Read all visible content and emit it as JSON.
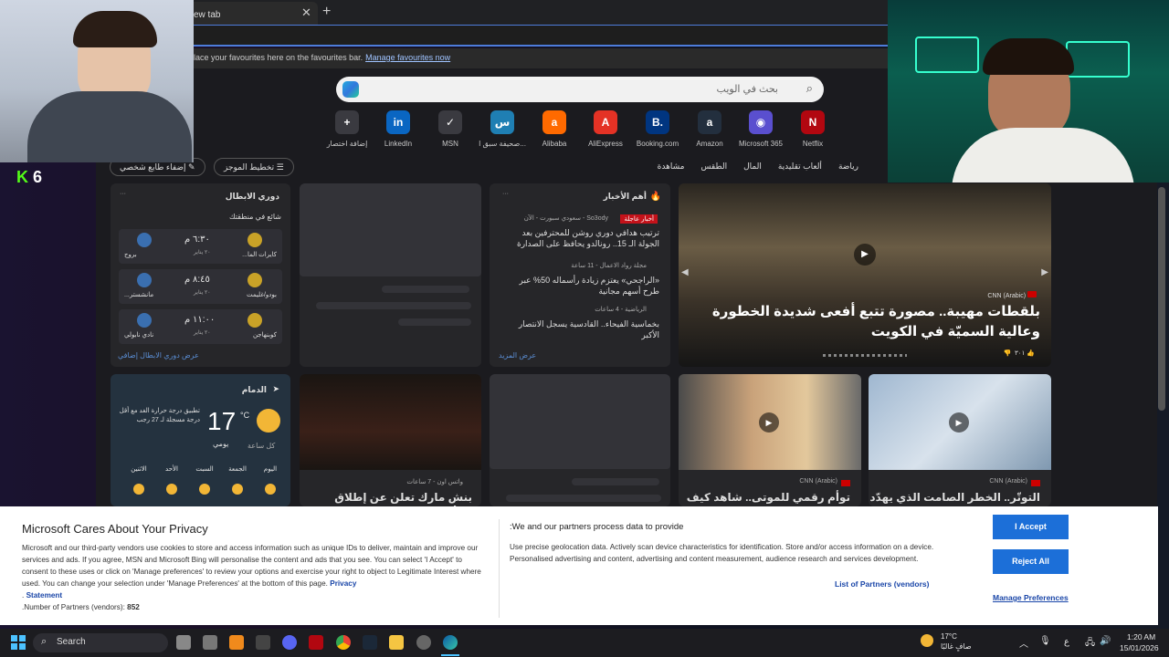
{
  "browser": {
    "tab_title": "ew tab",
    "close_glyph": "✕",
    "new_tab_glyph": "+",
    "fav_text": "lace your favourites here on the favourites bar.",
    "fav_link": "Manage favourites now"
  },
  "search": {
    "placeholder": "بحث في الويب"
  },
  "quick_links": [
    {
      "label": "إضافة اختصار",
      "glyph": "+",
      "color": "#3a3a40"
    },
    {
      "label": "LinkedIn",
      "glyph": "in",
      "color": "#0a66c2"
    },
    {
      "label": "MSN",
      "glyph": "✓",
      "color": "#3a3a40"
    },
    {
      "label": "صحيفة سبق ا...",
      "glyph": "س",
      "color": "#1f7fb3"
    },
    {
      "label": "Alibaba",
      "glyph": "a",
      "color": "#ff6a00"
    },
    {
      "label": "AliExpress",
      "glyph": "A",
      "color": "#e43225"
    },
    {
      "label": "Booking.com",
      "glyph": "B.",
      "color": "#003580"
    },
    {
      "label": "Amazon",
      "glyph": "a",
      "color": "#232f3e"
    },
    {
      "label": "Microsoft 365",
      "glyph": "◉",
      "color": "#5a4fcf"
    },
    {
      "label": "Netflix",
      "glyph": "N",
      "color": "#b20710"
    }
  ],
  "toolbar": {
    "personalize": "إضفاء طابع شخصي",
    "layout": "تخطيط الموجز"
  },
  "nav_links": [
    "رياضة",
    "ألعاب تقليدية",
    "المال",
    "الطقس",
    "مشاهدة"
  ],
  "league": {
    "title": "دوري الابطال",
    "trending": "شائع في منطقتك",
    "matches": [
      {
        "home": "كايرات الما...",
        "away": "بروج",
        "time": "٦:٣٠ م",
        "date": "٢٠ يناير"
      },
      {
        "home": "بودو/غليمت",
        "away": "مانشستر...",
        "time": "٨:٤٥ م",
        "date": "٢٠ يناير"
      },
      {
        "home": "كوبنهاجن",
        "away": "نادي نابولي",
        "time": "١١:٠٠ م",
        "date": "٢٠ يناير"
      }
    ],
    "more": "عرض دوري الابطال إضافي"
  },
  "news": {
    "title": "أهم الأخبار",
    "breaking": "أخبار عاجلة",
    "items": [
      {
        "source": "So3ody - سعودي سبورت - الآن",
        "headline": "ترتيب هدافي دوري روشن للمحترفين بعد الجولة الـ 15.. رونالدو يحافظ على الصدارة"
      },
      {
        "source": "مجلة رواد الاعمال - 11 ساعة",
        "headline": "«الراجحي» يعتزم زيادة رأسماله 50% عبر طرح أسهم مجانية"
      },
      {
        "source": "الرياضية - 4 ساعات",
        "headline": "بخماسية الفيحاء.. القادسية يسجل الانتصار الأكبر"
      }
    ],
    "more": "عرض المزيد"
  },
  "hero": {
    "source": "CNN (Arabic)",
    "headline": "بلقطات مهيبة.. مصورة تتبع أفعى شديدة الخطورة وعالية السميّة في الكويت",
    "likes": "٣٠١"
  },
  "weather": {
    "city": "الدمام",
    "temp": "17",
    "unit": "°C",
    "note": "تطبيق درجة حرارة الغد مع أقل درجة مسجلة لـ 27 رجب",
    "tabs": [
      "كل ساعة",
      "يومي"
    ],
    "days": [
      "اليوم",
      "الجمعة",
      "السبت",
      "الأحد",
      "الاثنين"
    ]
  },
  "bottom_cards": [
    {
      "source": "واتس اون - 7 ساعات",
      "headline": "بنش مارك تعلن عن إطلاق برنامج"
    },
    {
      "source": "CNN (Arabic)",
      "headline": "توأم رقمي للموتى.. شاهد كيف"
    },
    {
      "source": "CNN (Arabic)",
      "headline": "التوتّر.. الخطر الصامت الذي يهدّد"
    }
  ],
  "privacy": {
    "title": "Microsoft Cares About Your Privacy",
    "body": "Microsoft and our third-party vendors use cookies to store and access information such as unique IDs to deliver, maintain and improve our services and ads. If you agree, MSN and Microsoft Bing will personalise the content and ads that you see. You can select 'I Accept' to consent to these uses or click on 'Manage preferences' to review your options and exercise your right to object to Legitimate Interest where used. You can change your selection under 'Manage Preferences' at the bottom of this page.",
    "privacy_link": "Privacy",
    "statement_link": "Statement",
    "partners_count_label": ".Number of Partners (vendors):",
    "partners_count": "852",
    "right_title": ":We and our partners process data to provide",
    "right_body": "Use precise geolocation data. Actively scan device characteristics for identification. Store and/or access information on a device. Personalised advertising and content, advertising and content measurement, audience research and services development.",
    "list_partners": "List of Partners (vendors)",
    "accept": "I Accept",
    "reject": "Reject All",
    "manage": "Manage Preferences"
  },
  "taskbar": {
    "search": "Search",
    "weather_temp": "17°C",
    "weather_desc": "صافٍ غالبًا",
    "lang": "ع",
    "time": "1:20 AM",
    "date": "15/01/2026"
  },
  "overlay": {
    "kick_letter": "K",
    "viewer_count": "6"
  }
}
